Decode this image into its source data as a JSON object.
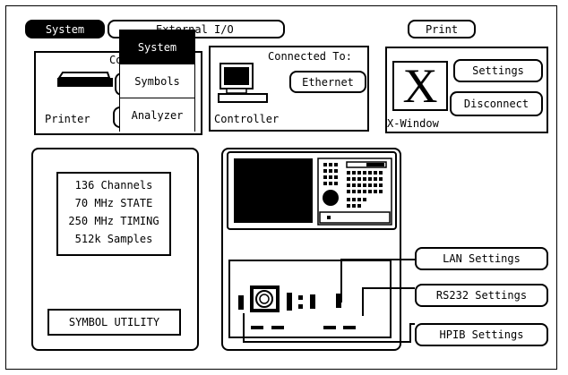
{
  "tabs": {
    "system": "System",
    "external_io": "External I/O",
    "print": "Print"
  },
  "dropdown": {
    "items": [
      "System",
      "Symbols",
      "Analyzer"
    ],
    "selected": "System"
  },
  "printer_box": {
    "heading_partial": "Conn",
    "label": "Printer"
  },
  "controller_box": {
    "connected_to_label": "Connected To:",
    "connection_button": "Ethernet",
    "label": "Controller"
  },
  "xwindow_box": {
    "glyph": "X",
    "label": "X-Window",
    "settings_button": "Settings",
    "disconnect_button": "Disconnect"
  },
  "specs": {
    "lines": [
      "136 Channels",
      "70 MHz STATE",
      "250 MHz TIMING",
      "512k Samples"
    ]
  },
  "symbol_utility": "SYMBOL UTILITY",
  "io_settings": {
    "lan": "LAN Settings",
    "rs232": "RS232 Settings",
    "hpib": "HPIB Settings"
  },
  "icons": [
    "printer-icon",
    "computer-icon",
    "x-window-icon",
    "instrument-front-icon",
    "rear-panel-icon"
  ]
}
